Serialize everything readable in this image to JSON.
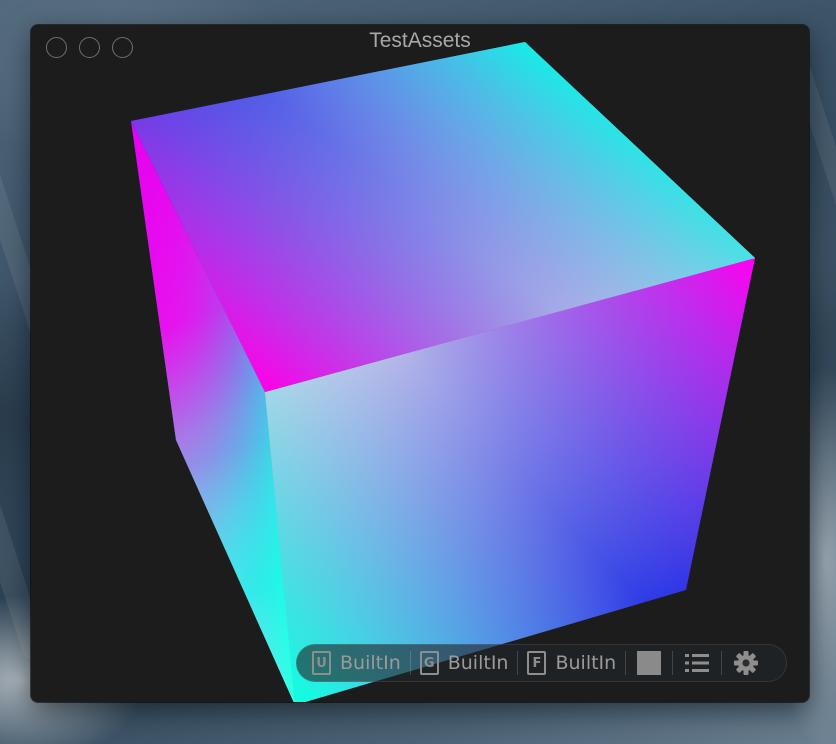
{
  "window": {
    "title": "TestAssets",
    "traffic_lights": [
      "close-button",
      "minimize-button",
      "zoom-button"
    ]
  },
  "viewport": {
    "object": "gradient-cube"
  },
  "toolbar": {
    "items": [
      {
        "icon": "U",
        "label": "BuiltIn"
      },
      {
        "icon": "G",
        "label": "BuiltIn"
      },
      {
        "icon": "F",
        "label": "BuiltIn"
      }
    ],
    "color_swatch": "#8a8a8a",
    "list_icon": "list-icon",
    "settings_icon": "gear-icon"
  }
}
